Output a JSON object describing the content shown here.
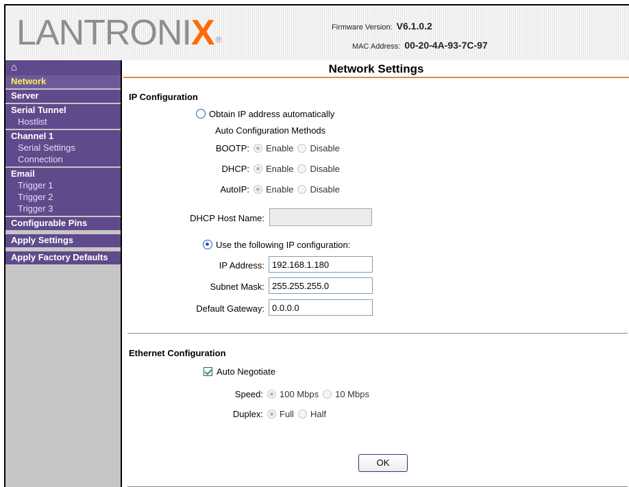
{
  "header": {
    "logo_main": "LANTRONI",
    "logo_x": "X",
    "logo_reg": "®",
    "firmware_label": "Firmware Version:",
    "firmware_value": "V6.1.0.2",
    "mac_label": "MAC Address:",
    "mac_value": "00-20-4A-93-7C-97"
  },
  "sidebar": {
    "home_icon": "⌂",
    "network": "Network",
    "server": "Server",
    "serial_tunnel": "Serial Tunnel",
    "hostlist": "Hostlist",
    "channel1": "Channel 1",
    "serial_settings": "Serial Settings",
    "connection": "Connection",
    "email": "Email",
    "trigger1": "Trigger 1",
    "trigger2": "Trigger 2",
    "trigger3": "Trigger 3",
    "configurable_pins": "Configurable Pins",
    "apply_settings": "Apply Settings",
    "apply_factory_defaults": "Apply Factory Defaults"
  },
  "page": {
    "title": "Network Settings"
  },
  "ip_config": {
    "section_title": "IP Configuration",
    "obtain_auto": "Obtain IP address automatically",
    "auto_methods": "Auto Configuration Methods",
    "bootp_label": "BOOTP:",
    "dhcp_label": "DHCP:",
    "autoip_label": "AutoIP:",
    "enable": "Enable",
    "disable": "Disable",
    "dhcp_host_label": "DHCP Host Name:",
    "dhcp_host_value": "",
    "use_following": "Use the following IP configuration:",
    "ip_label": "IP Address:",
    "ip_value": "192.168.1.180",
    "subnet_label": "Subnet Mask:",
    "subnet_value": "255.255.255.0",
    "gateway_label": "Default Gateway:",
    "gateway_value": "0.0.0.0"
  },
  "ethernet": {
    "section_title": "Ethernet Configuration",
    "auto_negotiate": "Auto Negotiate",
    "speed_label": "Speed:",
    "speed_100": "100 Mbps",
    "speed_10": "10 Mbps",
    "duplex_label": "Duplex:",
    "duplex_full": "Full",
    "duplex_half": "Half"
  },
  "buttons": {
    "ok": "OK"
  }
}
